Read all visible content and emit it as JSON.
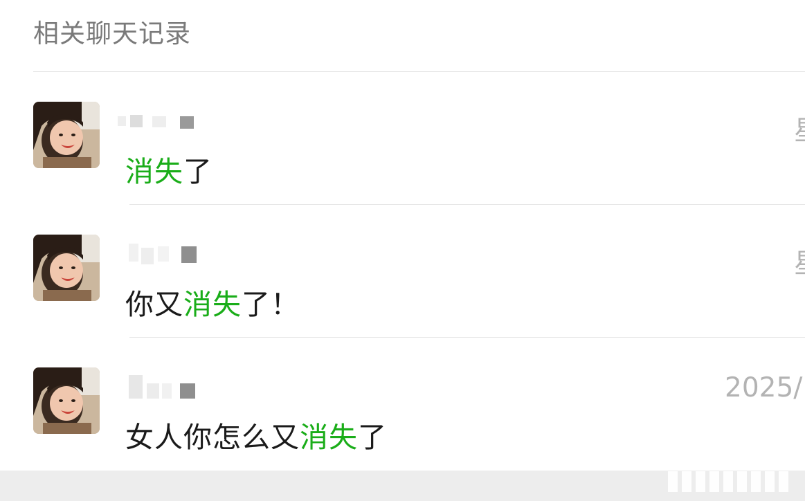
{
  "header": {
    "title": "相关聊天记录"
  },
  "results": [
    {
      "time": "星",
      "message_parts": [
        {
          "text": "消失",
          "highlight": true
        },
        {
          "text": "了",
          "highlight": false
        }
      ]
    },
    {
      "time": "星",
      "message_parts": [
        {
          "text": "你又",
          "highlight": false
        },
        {
          "text": "消失",
          "highlight": true
        },
        {
          "text": "了！",
          "highlight": false
        }
      ]
    },
    {
      "time": "2025/",
      "message_parts": [
        {
          "text": "女人你怎么又",
          "highlight": false
        },
        {
          "text": "消失",
          "highlight": true
        },
        {
          "text": "了",
          "highlight": false
        }
      ]
    }
  ],
  "colors": {
    "highlight": "#1aad19",
    "title": "#7a7a7a",
    "time": "#b3b3b3",
    "text": "#1a1a1a",
    "divider": "#e6e6e6"
  },
  "icons": {
    "avatar": "child-photo-avatar"
  }
}
